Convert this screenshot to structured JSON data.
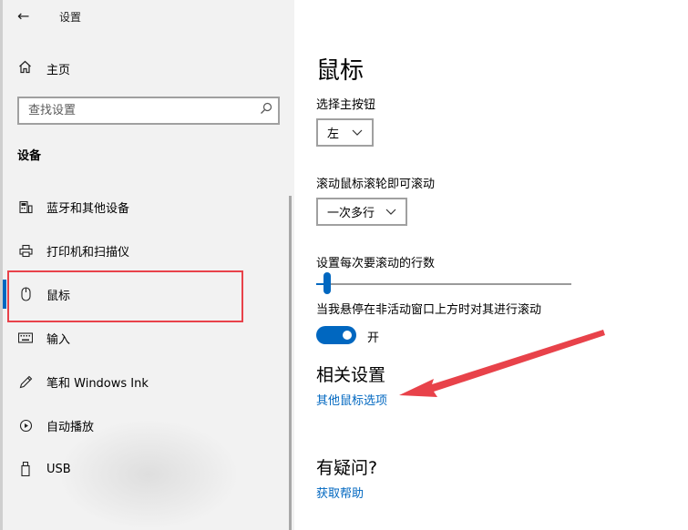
{
  "app": {
    "title": "设置",
    "back_glyph": "←"
  },
  "sidebar": {
    "home_label": "主页",
    "search_placeholder": "查找设置",
    "section": "设备",
    "items": [
      {
        "label": "蓝牙和其他设备",
        "icon": "bluetooth-devices-icon",
        "selected": false
      },
      {
        "label": "打印机和扫描仪",
        "icon": "printer-icon",
        "selected": false
      },
      {
        "label": "鼠标",
        "icon": "mouse-icon",
        "selected": true
      },
      {
        "label": "输入",
        "icon": "keyboard-icon",
        "selected": false
      },
      {
        "label": "笔和 Windows Ink",
        "icon": "pen-icon",
        "selected": false
      },
      {
        "label": "自动播放",
        "icon": "autoplay-icon",
        "selected": false
      },
      {
        "label": "USB",
        "icon": "usb-icon",
        "selected": false
      }
    ]
  },
  "main": {
    "title": "鼠标",
    "primary_button": {
      "label": "选择主按钮",
      "value": "左"
    },
    "wheel_scroll": {
      "label": "滚动鼠标滚轮即可滚动",
      "value": "一次多行"
    },
    "lines_to_scroll": {
      "label": "设置每次要滚动的行数",
      "value_fraction": 0.02
    },
    "inactive_scroll": {
      "label": "当我悬停在非活动窗口上方时对其进行滚动",
      "state": "开",
      "on": true
    },
    "related": {
      "heading": "相关设置",
      "link": "其他鼠标选项"
    },
    "help": {
      "heading": "有疑问?",
      "link": "获取帮助"
    }
  },
  "colors": {
    "accent": "#0067c0",
    "annotation": "#e8424a",
    "sidebar_bg": "#f2f2f2"
  }
}
